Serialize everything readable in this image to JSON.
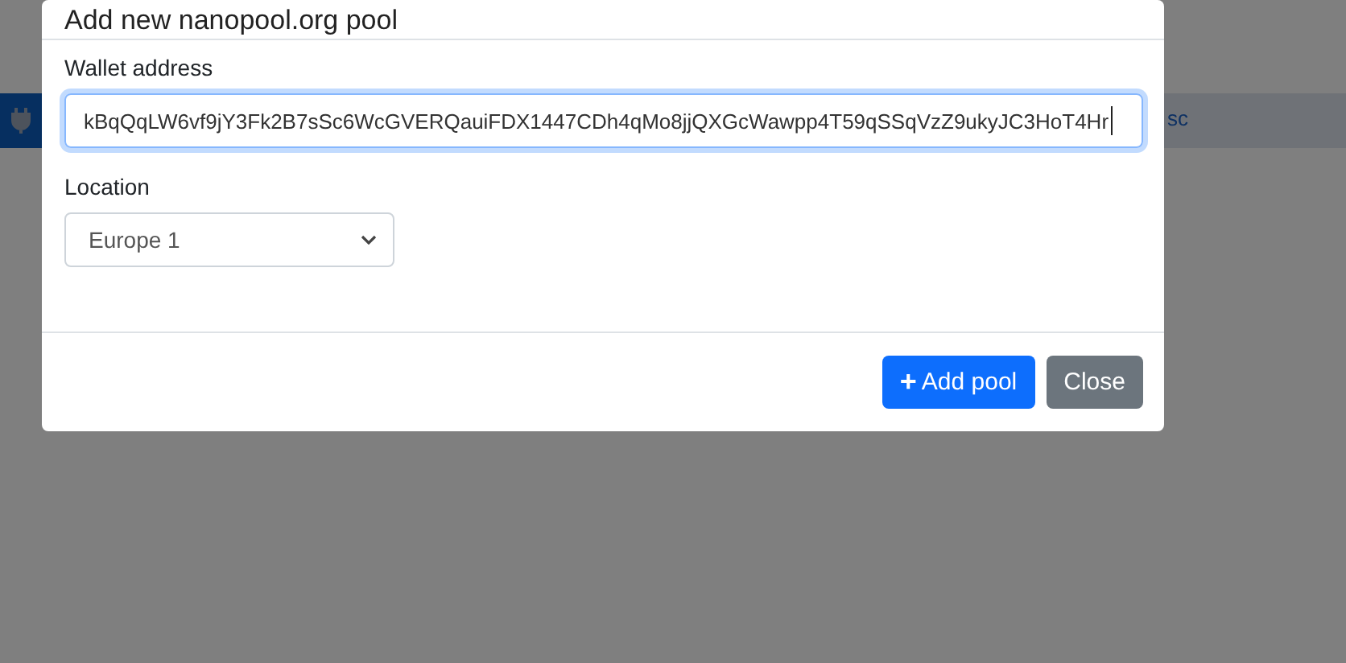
{
  "background": {
    "nav_text": "sc"
  },
  "modal": {
    "title": "Add new nanopool.org pool",
    "fields": [
      {
        "kind": "text",
        "label": "Wallet address",
        "value": "kBqQqLW6vf9jY3Fk2B7sSc6WcGVERQauiFDX1447CDh4qMo8jjQXGcWawpp4T59qSSqVzZ9ukyJC3HoT4Hr",
        "focused": true
      },
      {
        "kind": "select",
        "label": "Location",
        "value": "Europe 1",
        "focused": false
      }
    ],
    "buttons": [
      {
        "kind": "primary",
        "icon": "+",
        "label": "Add pool"
      },
      {
        "kind": "secondary",
        "label": "Close"
      }
    ]
  }
}
